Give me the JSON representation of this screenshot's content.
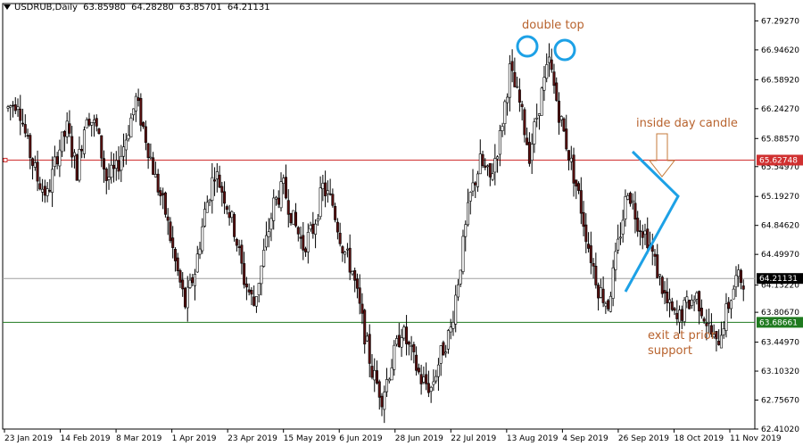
{
  "header": {
    "symbol": "USDRUB,Daily",
    "open": "63.85980",
    "high": "64.28280",
    "low": "63.85701",
    "close": "64.21131"
  },
  "colors": {
    "background": "#ffffff",
    "axis": "#000000",
    "candle_up_fill": "#ffffff",
    "candle_down_fill": "#000000",
    "candle_down_body_dark": "#5a1010",
    "red_line": "#d03030",
    "red_tag": "#d03030",
    "green_line": "#1f7a1f",
    "green_tag": "#1f7a1f",
    "grey_line": "#a0a0a0",
    "bid_tag": "#000000",
    "annotation_text": "#b8632e",
    "circle": "#1da1e6",
    "triangle": "#1da1e6",
    "arrow_outline": "#c47a3a"
  },
  "annotations": {
    "double_top": "double top",
    "inside_day": "inside day candle",
    "exit_line1": "exit at prior",
    "exit_line2": "support"
  },
  "chart_data": {
    "type": "candlestick",
    "title": "USDRUB,Daily",
    "ylim": [
      62.41,
      67.5
    ],
    "y_ticks": [
      "67.29270",
      "66.94620",
      "66.58920",
      "66.24270",
      "65.88570",
      "65.54970",
      "65.19270",
      "64.84620",
      "64.49970",
      "64.13220",
      "63.80670",
      "63.44970",
      "63.10320",
      "62.75670",
      "62.41020"
    ],
    "x_ticks": [
      "23 Jan 2019",
      "14 Feb 2019",
      "8 Mar 2019",
      "1 Apr 2019",
      "23 Apr 2019",
      "15 May 2019",
      "6 Jun 2019",
      "28 Jun 2019",
      "22 Jul 2019",
      "13 Aug 2019",
      "4 Sep 2019",
      "26 Sep 2019",
      "18 Oct 2019",
      "11 Nov 2019"
    ],
    "levels": [
      {
        "name": "resistance",
        "value": 65.62748,
        "label": "65.62748",
        "color": "#d03030"
      },
      {
        "name": "current-price",
        "value": 64.21131,
        "label": "64.21131",
        "color": "#000000"
      },
      {
        "name": "support",
        "value": 63.68661,
        "label": "63.68661",
        "color": "#1f7a1f"
      }
    ],
    "close_path": [
      [
        0,
        66.25
      ],
      [
        4,
        66.35
      ],
      [
        8,
        65.8
      ],
      [
        12,
        65.4
      ],
      [
        16,
        65.2
      ],
      [
        20,
        65.7
      ],
      [
        24,
        66.0
      ],
      [
        28,
        65.5
      ],
      [
        32,
        66.2
      ],
      [
        36,
        66.0
      ],
      [
        40,
        65.4
      ],
      [
        44,
        65.5
      ],
      [
        48,
        65.9
      ],
      [
        52,
        66.35
      ],
      [
        56,
        65.9
      ],
      [
        60,
        65.4
      ],
      [
        64,
        65.0
      ],
      [
        68,
        64.4
      ],
      [
        72,
        63.9
      ],
      [
        76,
        64.3
      ],
      [
        80,
        65.0
      ],
      [
        84,
        65.5
      ],
      [
        88,
        65.2
      ],
      [
        92,
        64.8
      ],
      [
        96,
        64.2
      ],
      [
        100,
        63.9
      ],
      [
        104,
        64.5
      ],
      [
        108,
        65.1
      ],
      [
        112,
        65.3
      ],
      [
        116,
        64.9
      ],
      [
        120,
        64.6
      ],
      [
        124,
        64.8
      ],
      [
        128,
        65.3
      ],
      [
        132,
        65.1
      ],
      [
        136,
        64.6
      ],
      [
        140,
        64.3
      ],
      [
        144,
        63.7
      ],
      [
        148,
        63.1
      ],
      [
        152,
        62.8
      ],
      [
        156,
        63.2
      ],
      [
        160,
        63.6
      ],
      [
        164,
        63.3
      ],
      [
        168,
        63.0
      ],
      [
        172,
        62.9
      ],
      [
        176,
        63.3
      ],
      [
        180,
        63.6
      ],
      [
        184,
        64.4
      ],
      [
        188,
        65.2
      ],
      [
        192,
        65.6
      ],
      [
        196,
        65.4
      ],
      [
        200,
        65.9
      ],
      [
        204,
        66.7
      ],
      [
        208,
        66.3
      ],
      [
        212,
        65.7
      ],
      [
        216,
        66.3
      ],
      [
        220,
        66.8
      ],
      [
        224,
        66.2
      ],
      [
        228,
        65.7
      ],
      [
        232,
        65.2
      ],
      [
        236,
        64.6
      ],
      [
        240,
        64.1
      ],
      [
        244,
        63.9
      ],
      [
        248,
        64.6
      ],
      [
        252,
        65.3
      ],
      [
        256,
        64.9
      ],
      [
        260,
        64.7
      ],
      [
        264,
        64.3
      ],
      [
        268,
        63.9
      ],
      [
        272,
        63.7
      ],
      [
        276,
        63.9
      ],
      [
        280,
        64.0
      ],
      [
        284,
        63.7
      ],
      [
        288,
        63.4
      ],
      [
        292,
        63.8
      ],
      [
        296,
        64.2
      ]
    ]
  }
}
